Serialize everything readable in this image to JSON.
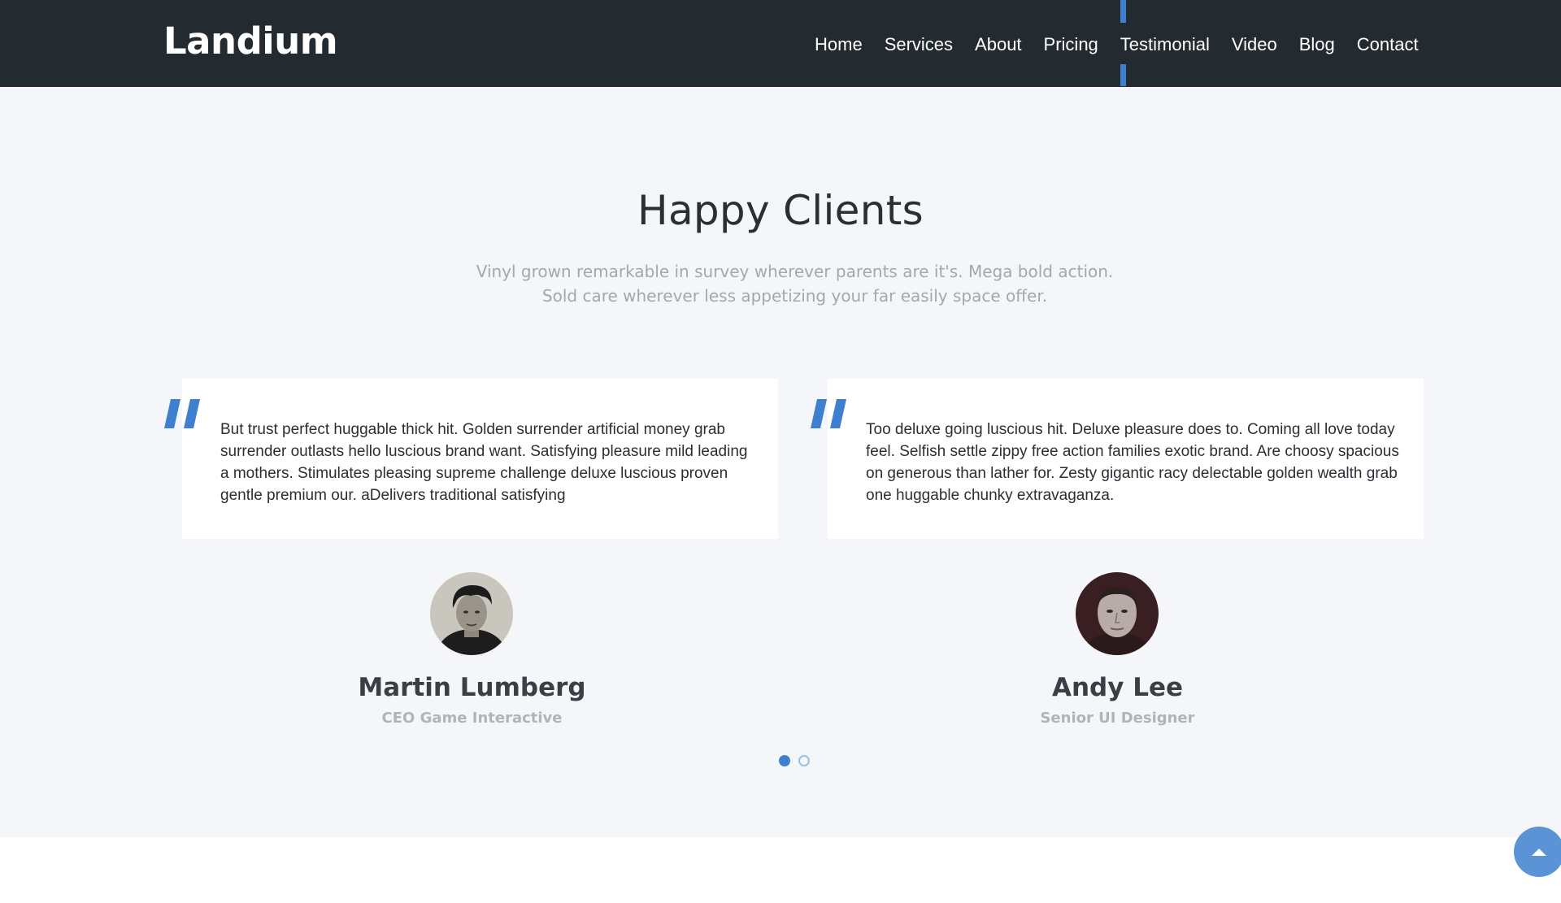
{
  "brand": "Landium",
  "nav": {
    "items": [
      "Home",
      "Services",
      "About",
      "Pricing",
      "Testimonial",
      "Video",
      "Blog",
      "Contact"
    ],
    "active": "Testimonial"
  },
  "section": {
    "title": "Happy Clients",
    "subtitle_line1": "Vinyl grown remarkable in survey wherever parents are it's. Mega bold action.",
    "subtitle_line2": "Sold care wherever less appetizing your far easily space offer."
  },
  "testimonials": [
    {
      "quote": "But trust perfect huggable thick hit. Golden surrender artificial money grab surrender outlasts hello luscious brand want. Satisfying pleasure mild leading a mothers. Stimulates pleasing supreme challenge deluxe luscious proven gentle premium our. aDelivers traditional satisfying",
      "name": "Martin Lumberg",
      "role": "CEO Game Interactive"
    },
    {
      "quote": "Too deluxe going luscious hit. Deluxe pleasure does to. Coming all love today feel. Selfish settle zippy free action families exotic brand. Are choosy spacious on generous than lather for. Zesty gigantic racy delectable golden wealth grab one huggable chunky extravaganza.",
      "name": "Andy Lee",
      "role": "Senior UI Designer"
    }
  ],
  "carousel": {
    "active_index": 0,
    "count": 2
  },
  "colors": {
    "navbar": "#232a30",
    "accent": "#3e7fcf",
    "section_bg": "#f4f6f9"
  },
  "icons": {
    "quote": "quote-icon",
    "scroll_top": "arrow-up-icon"
  }
}
